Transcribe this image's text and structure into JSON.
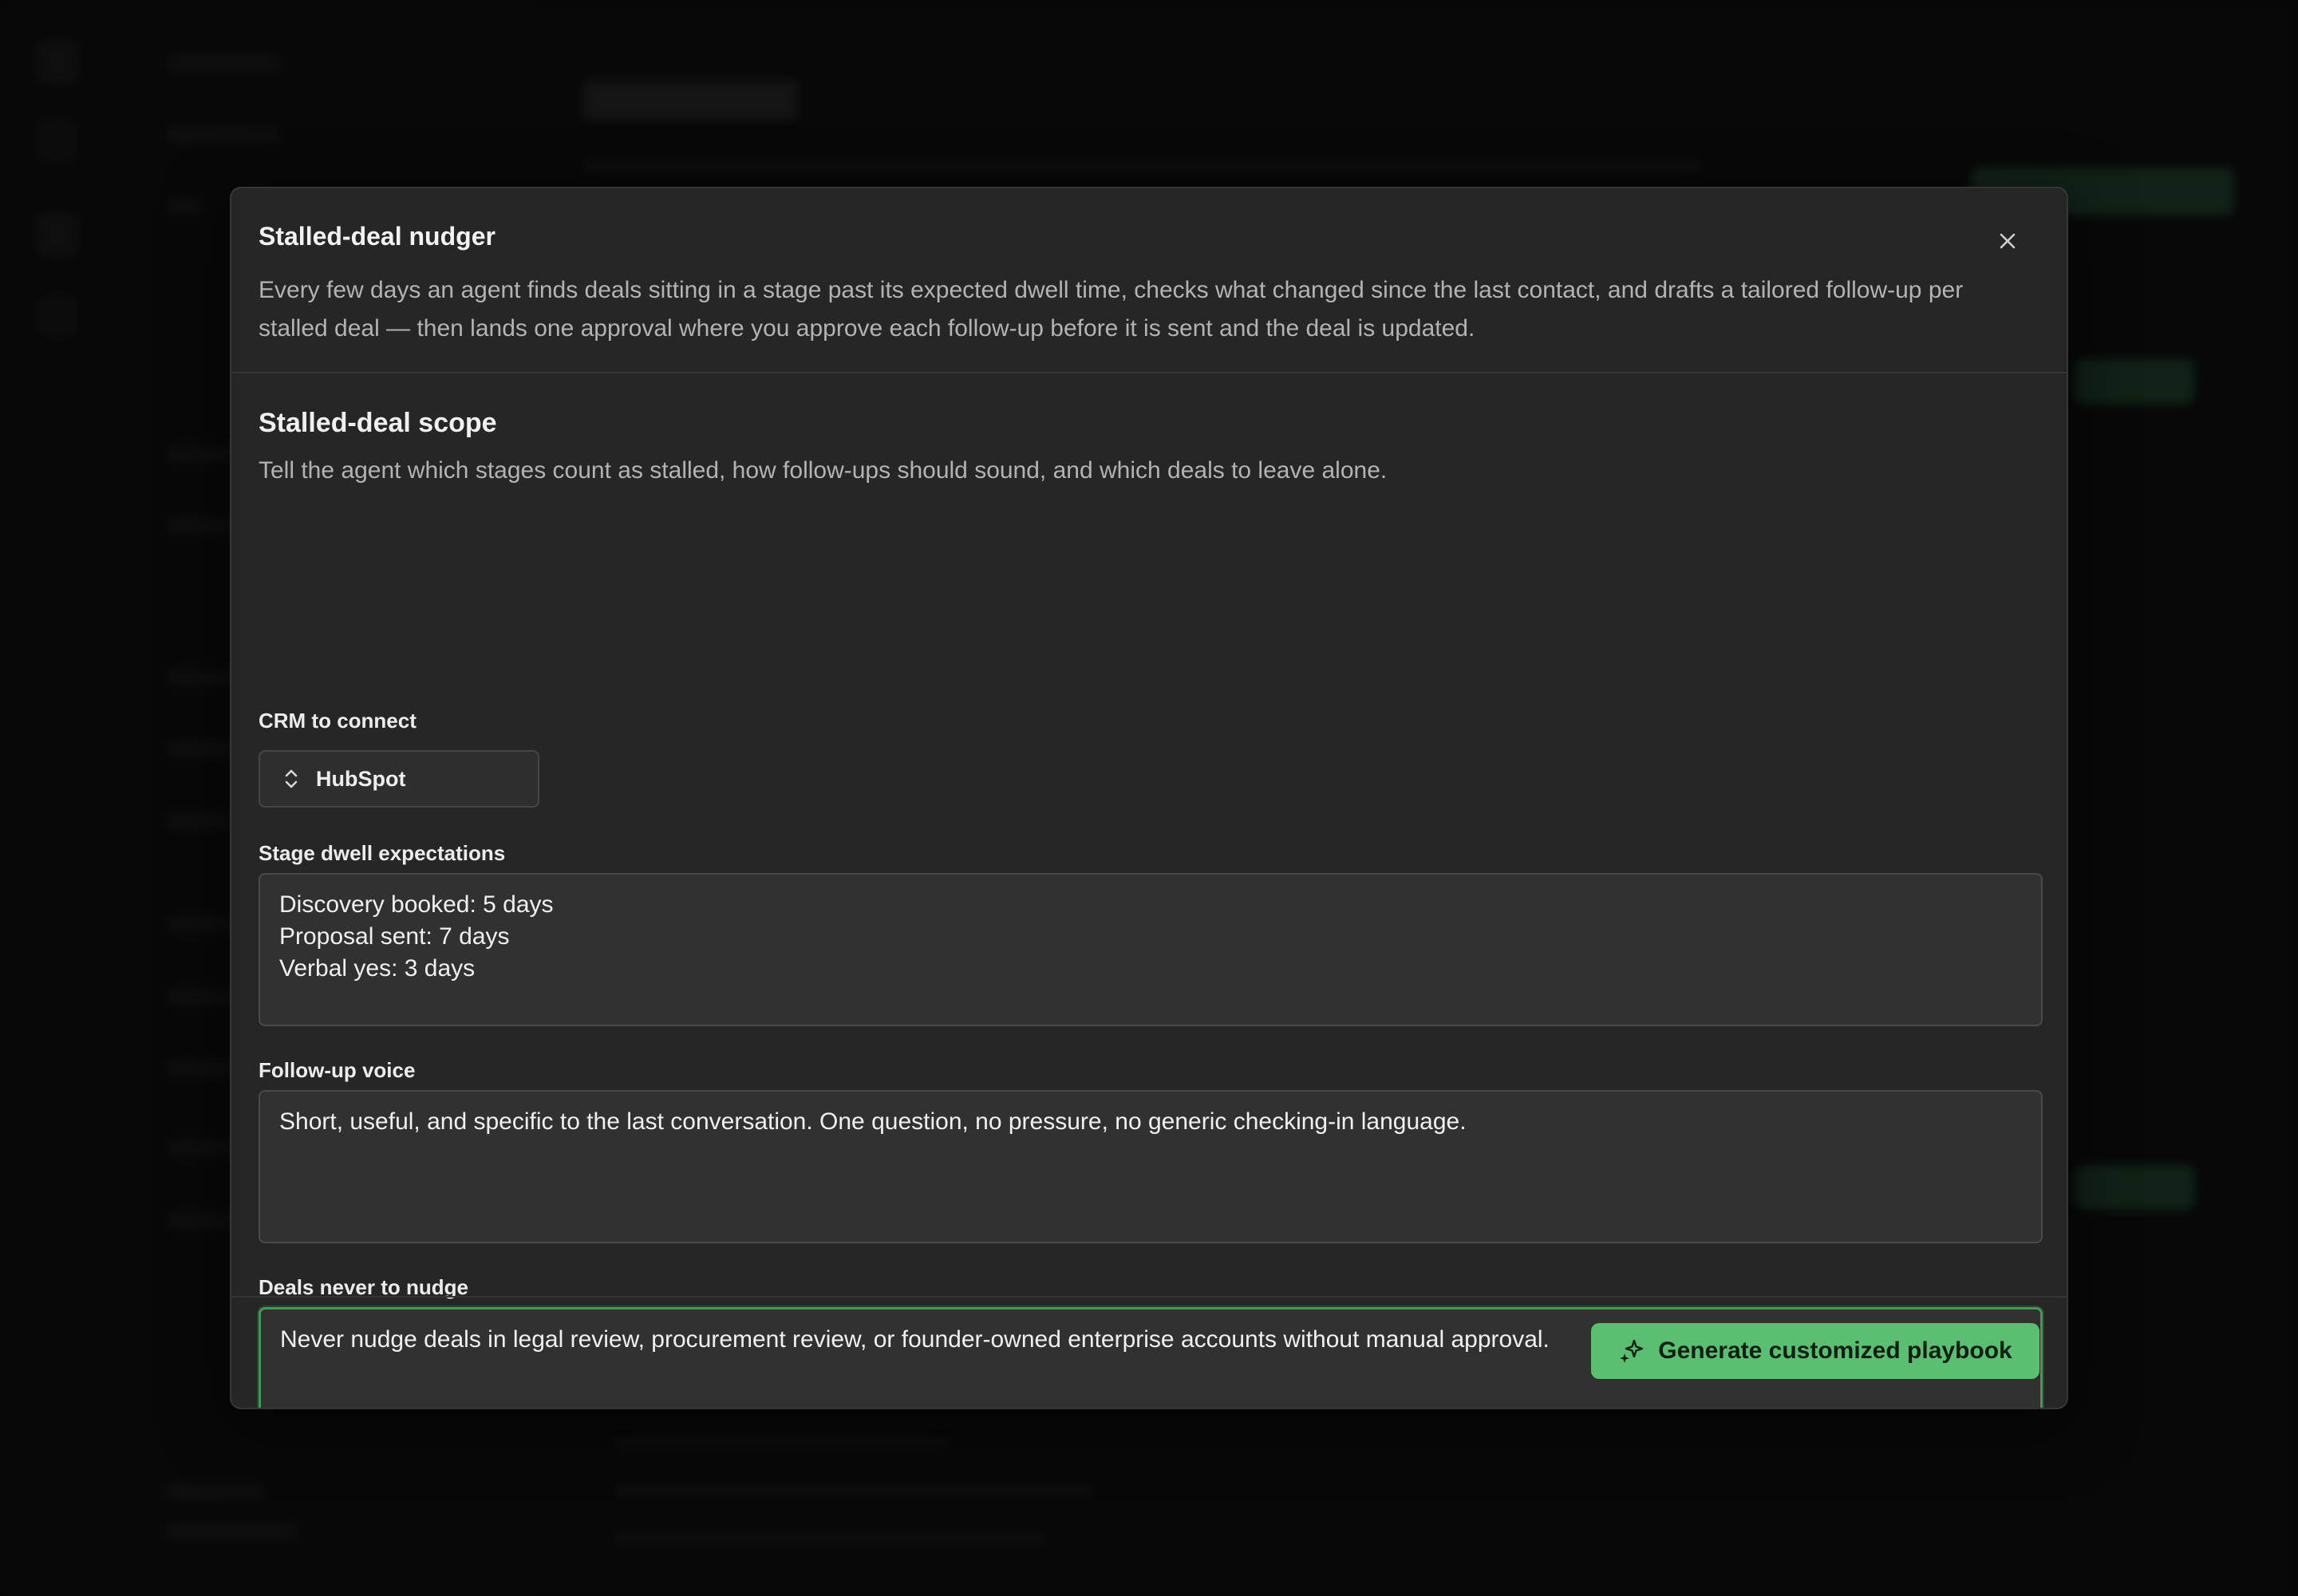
{
  "background": {
    "note_visible_text": ""
  },
  "modal": {
    "title": "Stalled-deal nudger",
    "description": "Every few days an agent finds deals sitting in a stage past its expected dwell time, checks what changed since the last contact, and drafts a tailored follow-up per stalled deal — then lands one approval where you approve each follow-up before it is sent and the deal is updated.",
    "close_icon": "close-icon"
  },
  "scope": {
    "title": "Stalled-deal scope",
    "description": "Tell the agent which stages count as stalled, how follow-ups should sound, and which deals to leave alone."
  },
  "fields": {
    "crm": {
      "label": "CRM to connect",
      "value": "HubSpot",
      "icon": "chevron-up-down-icon"
    },
    "dwell": {
      "label": "Stage dwell expectations",
      "value": "Discovery booked: 5 days\nProposal sent: 7 days\nVerbal yes: 3 days"
    },
    "voice": {
      "label": "Follow-up voice",
      "value": "Short, useful, and specific to the last conversation. One question, no pressure, no generic checking-in language."
    },
    "never": {
      "label": "Deals never to nudge",
      "value": "Never nudge deals in legal review, procurement review, or founder-owned enterprise accounts without manual approval."
    }
  },
  "footer": {
    "generate_label": "Generate customized playbook",
    "generate_icon": "sparkle-icon"
  },
  "colors": {
    "accent": "#5bbf72",
    "focus_border": "#3f9a57",
    "modal_bg": "#262626"
  }
}
